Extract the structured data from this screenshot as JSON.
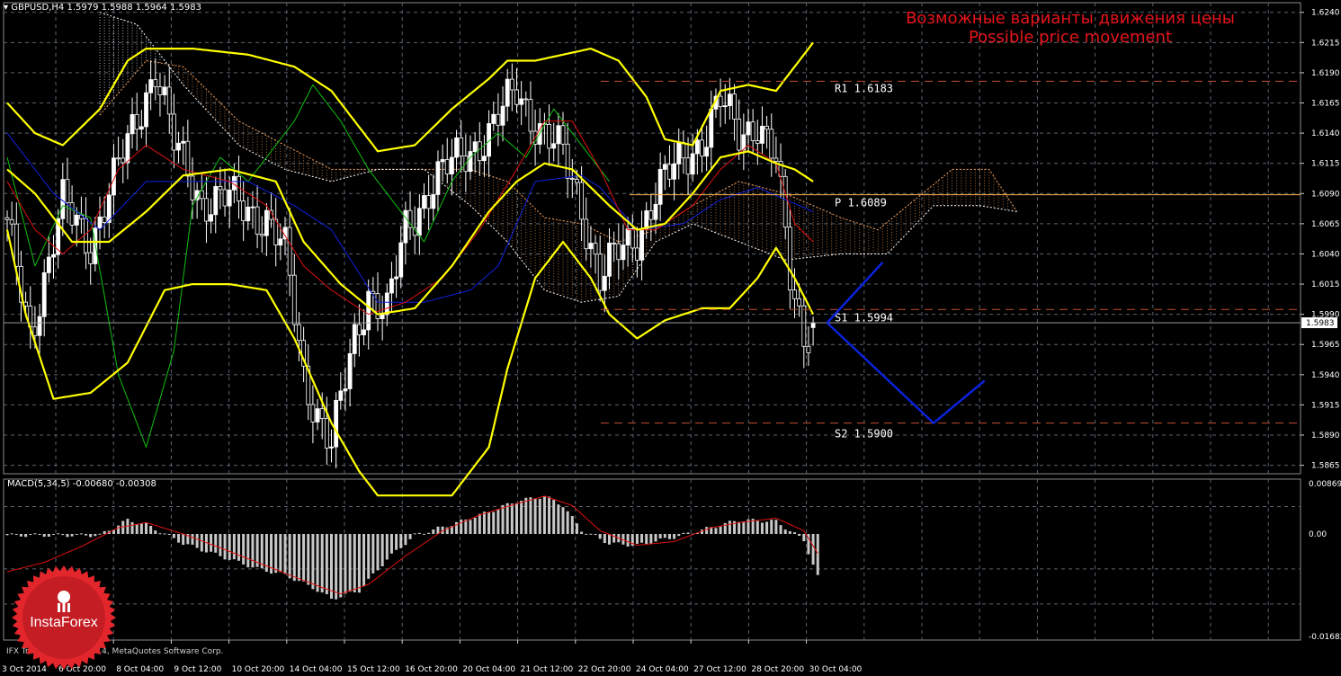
{
  "symbol_label": "GBPUSD,H4  1.5979 1.5988 1.5964 1.5983",
  "overlay": {
    "title_ru": "Возможные варианты движения цены",
    "title_en": "Possible price movement"
  },
  "pivots": {
    "r1": "R1  1.6183",
    "p": "P  1.6089",
    "s1": "S1  1.5994",
    "s2": "S2  1.5900"
  },
  "current_price_tag": "1.5983",
  "macd_label": "MACD(5,34,5) -0.00680 -0.00308",
  "copyright": "IFX Trader, © 2001-2014, MetaQuotes Software Corp.",
  "logo_text": "InstaForex",
  "colors": {
    "background": "#000000",
    "grid": "#5a6470",
    "bull_candle": "#ffffff",
    "bear_candle": "#000000",
    "bollinger": "#ffff00",
    "tenkan": "#e01010",
    "kijun": "#1020e0",
    "chikou": "#10c010",
    "pivot_line": "#c05030",
    "pivot_p_line": "#ffb347",
    "projection": "#0a22d8",
    "title": "#e8141b",
    "macd_hist": "#c8c8c8",
    "macd_signal": "#e01010",
    "logo": "#e3262c"
  },
  "icons": {
    "dropdown": "triangle-down-icon",
    "logo": "instaforex-logo-icon"
  },
  "chart_data": [
    {
      "type": "candlestick",
      "title": "GBPUSD,H4",
      "symbol": "GBPUSD",
      "timeframe": "H4",
      "ohlc_last": {
        "open": 1.5979,
        "high": 1.5988,
        "low": 1.5964,
        "close": 1.5983
      },
      "ylim": [
        1.5858,
        1.6248
      ],
      "y_ticks": [
        "1.6240",
        "1.6215",
        "1.6190",
        "1.6165",
        "1.6140",
        "1.6115",
        "1.6090",
        "1.6065",
        "1.6040",
        "1.6015",
        "1.5990",
        "1.5965",
        "1.5940",
        "1.5915",
        "1.5890",
        "1.5865"
      ],
      "x_ticks": [
        "3 Oct 2014",
        "6 Oct 20:00",
        "8 Oct 04:00",
        "9 Oct 12:00",
        "10 Oct 20:00",
        "14 Oct 04:00",
        "15 Oct 12:00",
        "16 Oct 20:00",
        "20 Oct 04:00",
        "21 Oct 12:00",
        "22 Oct 20:00",
        "24 Oct 04:00",
        "27 Oct 12:00",
        "28 Oct 20:00",
        "30 Oct 04:00"
      ],
      "close_anchors": [
        [
          0,
          1.606
        ],
        [
          5,
          1.5975
        ],
        [
          12,
          1.608
        ],
        [
          18,
          1.605
        ],
        [
          25,
          1.612
        ],
        [
          32,
          1.6195
        ],
        [
          36,
          1.613
        ],
        [
          42,
          1.6085
        ],
        [
          48,
          1.6085
        ],
        [
          56,
          1.607
        ],
        [
          60,
          1.604
        ],
        [
          64,
          1.594
        ],
        [
          70,
          1.588
        ],
        [
          75,
          1.597
        ],
        [
          78,
          1.601
        ],
        [
          82,
          1.599
        ],
        [
          86,
          1.606
        ],
        [
          92,
          1.61
        ],
        [
          98,
          1.612
        ],
        [
          104,
          1.614
        ],
        [
          110,
          1.6175
        ],
        [
          114,
          1.615
        ],
        [
          120,
          1.612
        ],
        [
          124,
          1.608
        ],
        [
          128,
          1.602
        ],
        [
          132,
          1.604
        ],
        [
          136,
          1.6055
        ],
        [
          140,
          1.609
        ],
        [
          146,
          1.612
        ],
        [
          150,
          1.6135
        ],
        [
          154,
          1.6165
        ],
        [
          158,
          1.614
        ],
        [
          162,
          1.615
        ],
        [
          166,
          1.6115
        ],
        [
          169,
          1.602
        ],
        [
          172,
          1.5975
        ],
        [
          174,
          1.5983
        ]
      ],
      "indicators": {
        "bollinger_upper": [
          [
            0,
            1.6165
          ],
          [
            6,
            1.614
          ],
          [
            12,
            1.613
          ],
          [
            20,
            1.616
          ],
          [
            26,
            1.62
          ],
          [
            30,
            1.621
          ],
          [
            40,
            1.621
          ],
          [
            52,
            1.6205
          ],
          [
            62,
            1.6195
          ],
          [
            70,
            1.6175
          ],
          [
            74,
            1.6155
          ],
          [
            80,
            1.6125
          ],
          [
            88,
            1.613
          ],
          [
            96,
            1.616
          ],
          [
            104,
            1.6185
          ],
          [
            108,
            1.62
          ],
          [
            114,
            1.62
          ],
          [
            120,
            1.6205
          ],
          [
            126,
            1.621
          ],
          [
            132,
            1.62
          ],
          [
            138,
            1.617
          ],
          [
            142,
            1.6135
          ],
          [
            148,
            1.613
          ],
          [
            154,
            1.6175
          ],
          [
            160,
            1.618
          ],
          [
            166,
            1.6175
          ],
          [
            170,
            1.6195
          ],
          [
            174,
            1.6215
          ]
        ],
        "bollinger_middle": [
          [
            0,
            1.611
          ],
          [
            6,
            1.609
          ],
          [
            14,
            1.605
          ],
          [
            22,
            1.605
          ],
          [
            30,
            1.6075
          ],
          [
            38,
            1.6105
          ],
          [
            48,
            1.611
          ],
          [
            58,
            1.61
          ],
          [
            64,
            1.605
          ],
          [
            72,
            1.6015
          ],
          [
            80,
            1.599
          ],
          [
            88,
            1.5995
          ],
          [
            96,
            1.603
          ],
          [
            104,
            1.6075
          ],
          [
            110,
            1.61
          ],
          [
            116,
            1.6115
          ],
          [
            122,
            1.611
          ],
          [
            130,
            1.608
          ],
          [
            136,
            1.606
          ],
          [
            142,
            1.6065
          ],
          [
            148,
            1.609
          ],
          [
            154,
            1.612
          ],
          [
            160,
            1.6125
          ],
          [
            166,
            1.6115
          ],
          [
            170,
            1.611
          ],
          [
            174,
            1.61
          ]
        ],
        "bollinger_lower": [
          [
            0,
            1.606
          ],
          [
            4,
            1.599
          ],
          [
            10,
            1.592
          ],
          [
            18,
            1.5925
          ],
          [
            26,
            1.595
          ],
          [
            34,
            1.601
          ],
          [
            40,
            1.6015
          ],
          [
            48,
            1.6015
          ],
          [
            56,
            1.601
          ],
          [
            62,
            1.597
          ],
          [
            70,
            1.59
          ],
          [
            76,
            1.586
          ],
          [
            80,
            1.584
          ],
          [
            96,
            1.584
          ],
          [
            104,
            1.588
          ],
          [
            108,
            1.5945
          ],
          [
            114,
            1.602
          ],
          [
            120,
            1.605
          ],
          [
            126,
            1.602
          ],
          [
            130,
            1.599
          ],
          [
            136,
            1.597
          ],
          [
            142,
            1.5985
          ],
          [
            150,
            1.5995
          ],
          [
            156,
            1.5995
          ],
          [
            162,
            1.602
          ],
          [
            166,
            1.6045
          ],
          [
            170,
            1.602
          ],
          [
            174,
            1.599
          ]
        ],
        "tenkan": [
          [
            0,
            1.61
          ],
          [
            6,
            1.606
          ],
          [
            12,
            1.604
          ],
          [
            18,
            1.606
          ],
          [
            24,
            1.611
          ],
          [
            30,
            1.613
          ],
          [
            38,
            1.611
          ],
          [
            48,
            1.61
          ],
          [
            56,
            1.608
          ],
          [
            64,
            1.603
          ],
          [
            70,
            1.601
          ],
          [
            78,
            1.599
          ],
          [
            86,
            1.6
          ],
          [
            94,
            1.602
          ],
          [
            102,
            1.606
          ],
          [
            110,
            1.611
          ],
          [
            116,
            1.615
          ],
          [
            122,
            1.615
          ],
          [
            128,
            1.611
          ],
          [
            134,
            1.606
          ],
          [
            140,
            1.606
          ],
          [
            148,
            1.608
          ],
          [
            154,
            1.611
          ],
          [
            160,
            1.613
          ],
          [
            166,
            1.6115
          ],
          [
            170,
            1.6065
          ],
          [
            174,
            1.605
          ]
        ],
        "kijun": [
          [
            0,
            1.614
          ],
          [
            10,
            1.609
          ],
          [
            20,
            1.606
          ],
          [
            30,
            1.61
          ],
          [
            40,
            1.61
          ],
          [
            52,
            1.61
          ],
          [
            62,
            1.608
          ],
          [
            70,
            1.606
          ],
          [
            80,
            1.6
          ],
          [
            90,
            1.6
          ],
          [
            100,
            1.601
          ],
          [
            106,
            1.603
          ],
          [
            114,
            1.61
          ],
          [
            124,
            1.6105
          ],
          [
            128,
            1.6095
          ],
          [
            136,
            1.606
          ],
          [
            146,
            1.6065
          ],
          [
            154,
            1.6085
          ],
          [
            162,
            1.6095
          ],
          [
            168,
            1.6085
          ],
          [
            174,
            1.6075
          ]
        ],
        "chikou": [
          [
            0,
            1.612
          ],
          [
            6,
            1.603
          ],
          [
            12,
            1.608
          ],
          [
            18,
            1.607
          ],
          [
            24,
            1.594
          ],
          [
            30,
            1.588
          ],
          [
            36,
            1.596
          ],
          [
            40,
            1.608
          ],
          [
            46,
            1.612
          ],
          [
            52,
            1.61
          ],
          [
            58,
            1.613
          ],
          [
            62,
            1.615
          ],
          [
            66,
            1.618
          ],
          [
            72,
            1.615
          ],
          [
            78,
            1.611
          ],
          [
            84,
            1.608
          ],
          [
            90,
            1.605
          ],
          [
            96,
            1.61
          ],
          [
            100,
            1.612
          ],
          [
            106,
            1.614
          ],
          [
            112,
            1.612
          ],
          [
            118,
            1.616
          ],
          [
            124,
            1.613
          ],
          [
            130,
            1.61
          ]
        ],
        "kumo_span_a": [
          [
            20,
            1.6155
          ],
          [
            30,
            1.62
          ],
          [
            38,
            1.6195
          ],
          [
            50,
            1.615
          ],
          [
            60,
            1.613
          ],
          [
            70,
            1.611
          ],
          [
            80,
            1.611
          ],
          [
            90,
            1.611
          ],
          [
            100,
            1.611
          ],
          [
            108,
            1.61
          ],
          [
            116,
            1.607
          ],
          [
            124,
            1.6065
          ],
          [
            132,
            1.605
          ],
          [
            140,
            1.606
          ],
          [
            148,
            1.608
          ],
          [
            158,
            1.61
          ],
          [
            168,
            1.609
          ],
          [
            180,
            1.607
          ],
          [
            188,
            1.606
          ],
          [
            196,
            1.6085
          ],
          [
            204,
            1.611
          ],
          [
            212,
            1.611
          ],
          [
            218,
            1.6075
          ]
        ],
        "kumo_span_b": [
          [
            20,
            1.624
          ],
          [
            28,
            1.623
          ],
          [
            38,
            1.618
          ],
          [
            50,
            1.613
          ],
          [
            60,
            1.611
          ],
          [
            70,
            1.61
          ],
          [
            80,
            1.611
          ],
          [
            90,
            1.611
          ],
          [
            100,
            1.608
          ],
          [
            108,
            1.605
          ],
          [
            116,
            1.601
          ],
          [
            124,
            1.6
          ],
          [
            132,
            1.6005
          ],
          [
            140,
            1.605
          ],
          [
            148,
            1.6065
          ],
          [
            158,
            1.605
          ],
          [
            168,
            1.6035
          ],
          [
            180,
            1.604
          ],
          [
            190,
            1.604
          ],
          [
            200,
            1.608
          ],
          [
            210,
            1.608
          ],
          [
            218,
            1.6075
          ]
        ],
        "pivots": {
          "R1": 1.6183,
          "P": 1.6089,
          "S1": 1.5994,
          "S2": 1.59
        },
        "projection_up": [
          [
            177,
            1.5983
          ],
          [
            189,
            1.6033
          ]
        ],
        "projection_down": [
          [
            177,
            1.5983
          ],
          [
            200,
            1.59
          ],
          [
            211,
            1.5935
          ]
        ]
      }
    },
    {
      "type": "bar",
      "title": "MACD(5,34,5)",
      "values_current": {
        "macd": -0.0068,
        "signal": -0.00308
      },
      "ylim": [
        -0.01682,
        0.00869
      ],
      "y_ticks": [
        "0.00869",
        "0.00",
        "-0.01682"
      ],
      "macd_anchors": [
        [
          0,
          -0.0002
        ],
        [
          12,
          -0.0002
        ],
        [
          20,
          -0.0002
        ],
        [
          26,
          0.0022
        ],
        [
          30,
          0.0015
        ],
        [
          38,
          -0.0015
        ],
        [
          46,
          -0.0035
        ],
        [
          54,
          -0.0055
        ],
        [
          60,
          -0.0065
        ],
        [
          66,
          -0.0085
        ],
        [
          70,
          -0.0103
        ],
        [
          76,
          -0.009
        ],
        [
          82,
          -0.004
        ],
        [
          88,
          -0.0002
        ],
        [
          96,
          0.0015
        ],
        [
          104,
          0.0035
        ],
        [
          110,
          0.0052
        ],
        [
          116,
          0.006
        ],
        [
          120,
          0.0045
        ],
        [
          124,
          0.0006
        ],
        [
          130,
          -0.0015
        ],
        [
          136,
          -0.0018
        ],
        [
          144,
          -0.0005
        ],
        [
          152,
          0.001
        ],
        [
          158,
          0.0022
        ],
        [
          166,
          0.002
        ],
        [
          172,
          -0.001
        ],
        [
          175,
          -0.0068
        ]
      ],
      "signal_anchors": [
        [
          0,
          -0.006
        ],
        [
          8,
          -0.0045
        ],
        [
          16,
          -0.002
        ],
        [
          24,
          0.001
        ],
        [
          30,
          0.0018
        ],
        [
          38,
          0.0
        ],
        [
          46,
          -0.0022
        ],
        [
          54,
          -0.0045
        ],
        [
          62,
          -0.0068
        ],
        [
          68,
          -0.0085
        ],
        [
          72,
          -0.0095
        ],
        [
          78,
          -0.008
        ],
        [
          86,
          -0.0035
        ],
        [
          94,
          0.0005
        ],
        [
          102,
          0.003
        ],
        [
          110,
          0.0048
        ],
        [
          116,
          0.006
        ],
        [
          122,
          0.0045
        ],
        [
          128,
          0.0005
        ],
        [
          136,
          -0.0018
        ],
        [
          144,
          -0.0012
        ],
        [
          152,
          0.001
        ],
        [
          158,
          0.0018
        ],
        [
          166,
          0.0025
        ],
        [
          172,
          0.0005
        ],
        [
          175,
          -0.0031
        ]
      ]
    }
  ]
}
